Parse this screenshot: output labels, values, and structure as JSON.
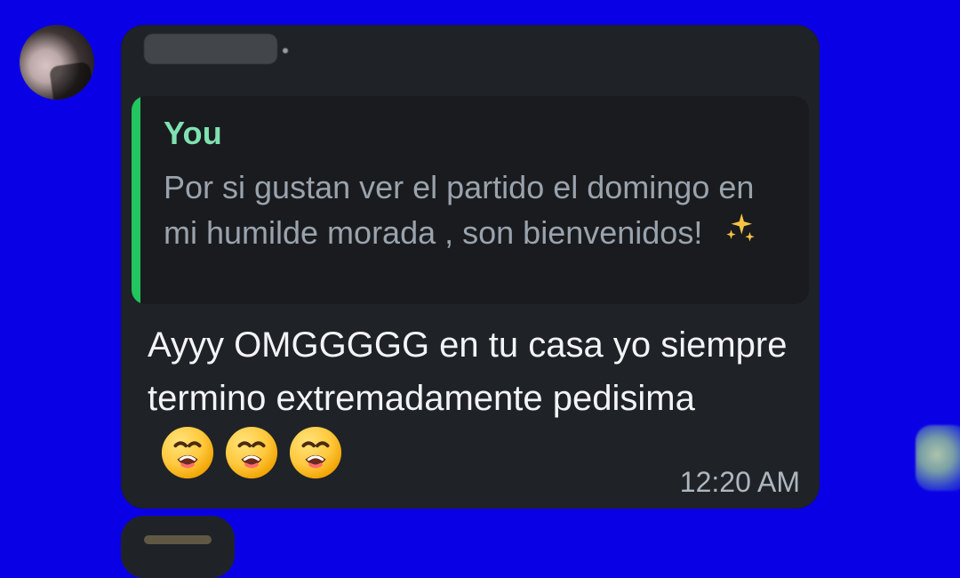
{
  "chat": {
    "message": {
      "reply": {
        "author": "You",
        "text": "Por si gustan ver el partido el domingo en mi humilde morada , son bienvenidos!"
      },
      "body_text": "Ayyy OMGGGGG en tu casa yo siempre termino extremadamente pedisima",
      "timestamp": "12:20 AM"
    }
  },
  "colors": {
    "background": "#0a00e6",
    "bubble": "#1f2328",
    "quote_bar": "#22c55e",
    "quote_author": "#7fe1b1"
  },
  "icons": {
    "sparkle": "sparkles-icon",
    "weary_face": "weary-face-icon"
  }
}
